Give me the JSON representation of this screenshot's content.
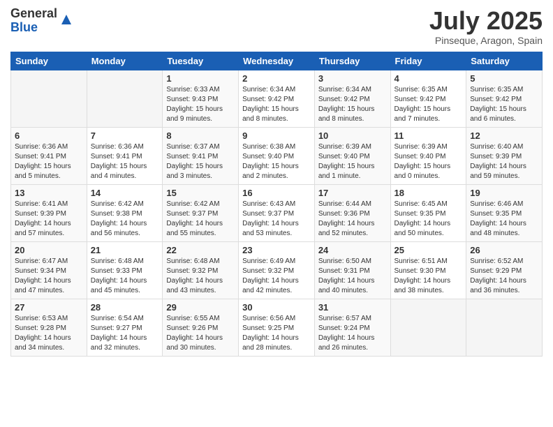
{
  "logo": {
    "general": "General",
    "blue": "Blue"
  },
  "title": "July 2025",
  "location": "Pinseque, Aragon, Spain",
  "days": [
    "Sunday",
    "Monday",
    "Tuesday",
    "Wednesday",
    "Thursday",
    "Friday",
    "Saturday"
  ],
  "weeks": [
    [
      {
        "day": "",
        "content": ""
      },
      {
        "day": "",
        "content": ""
      },
      {
        "day": "1",
        "content": "Sunrise: 6:33 AM\nSunset: 9:43 PM\nDaylight: 15 hours and 9 minutes."
      },
      {
        "day": "2",
        "content": "Sunrise: 6:34 AM\nSunset: 9:42 PM\nDaylight: 15 hours and 8 minutes."
      },
      {
        "day": "3",
        "content": "Sunrise: 6:34 AM\nSunset: 9:42 PM\nDaylight: 15 hours and 8 minutes."
      },
      {
        "day": "4",
        "content": "Sunrise: 6:35 AM\nSunset: 9:42 PM\nDaylight: 15 hours and 7 minutes."
      },
      {
        "day": "5",
        "content": "Sunrise: 6:35 AM\nSunset: 9:42 PM\nDaylight: 15 hours and 6 minutes."
      }
    ],
    [
      {
        "day": "6",
        "content": "Sunrise: 6:36 AM\nSunset: 9:41 PM\nDaylight: 15 hours and 5 minutes."
      },
      {
        "day": "7",
        "content": "Sunrise: 6:36 AM\nSunset: 9:41 PM\nDaylight: 15 hours and 4 minutes."
      },
      {
        "day": "8",
        "content": "Sunrise: 6:37 AM\nSunset: 9:41 PM\nDaylight: 15 hours and 3 minutes."
      },
      {
        "day": "9",
        "content": "Sunrise: 6:38 AM\nSunset: 9:40 PM\nDaylight: 15 hours and 2 minutes."
      },
      {
        "day": "10",
        "content": "Sunrise: 6:39 AM\nSunset: 9:40 PM\nDaylight: 15 hours and 1 minute."
      },
      {
        "day": "11",
        "content": "Sunrise: 6:39 AM\nSunset: 9:40 PM\nDaylight: 15 hours and 0 minutes."
      },
      {
        "day": "12",
        "content": "Sunrise: 6:40 AM\nSunset: 9:39 PM\nDaylight: 14 hours and 59 minutes."
      }
    ],
    [
      {
        "day": "13",
        "content": "Sunrise: 6:41 AM\nSunset: 9:39 PM\nDaylight: 14 hours and 57 minutes."
      },
      {
        "day": "14",
        "content": "Sunrise: 6:42 AM\nSunset: 9:38 PM\nDaylight: 14 hours and 56 minutes."
      },
      {
        "day": "15",
        "content": "Sunrise: 6:42 AM\nSunset: 9:37 PM\nDaylight: 14 hours and 55 minutes."
      },
      {
        "day": "16",
        "content": "Sunrise: 6:43 AM\nSunset: 9:37 PM\nDaylight: 14 hours and 53 minutes."
      },
      {
        "day": "17",
        "content": "Sunrise: 6:44 AM\nSunset: 9:36 PM\nDaylight: 14 hours and 52 minutes."
      },
      {
        "day": "18",
        "content": "Sunrise: 6:45 AM\nSunset: 9:35 PM\nDaylight: 14 hours and 50 minutes."
      },
      {
        "day": "19",
        "content": "Sunrise: 6:46 AM\nSunset: 9:35 PM\nDaylight: 14 hours and 48 minutes."
      }
    ],
    [
      {
        "day": "20",
        "content": "Sunrise: 6:47 AM\nSunset: 9:34 PM\nDaylight: 14 hours and 47 minutes."
      },
      {
        "day": "21",
        "content": "Sunrise: 6:48 AM\nSunset: 9:33 PM\nDaylight: 14 hours and 45 minutes."
      },
      {
        "day": "22",
        "content": "Sunrise: 6:48 AM\nSunset: 9:32 PM\nDaylight: 14 hours and 43 minutes."
      },
      {
        "day": "23",
        "content": "Sunrise: 6:49 AM\nSunset: 9:32 PM\nDaylight: 14 hours and 42 minutes."
      },
      {
        "day": "24",
        "content": "Sunrise: 6:50 AM\nSunset: 9:31 PM\nDaylight: 14 hours and 40 minutes."
      },
      {
        "day": "25",
        "content": "Sunrise: 6:51 AM\nSunset: 9:30 PM\nDaylight: 14 hours and 38 minutes."
      },
      {
        "day": "26",
        "content": "Sunrise: 6:52 AM\nSunset: 9:29 PM\nDaylight: 14 hours and 36 minutes."
      }
    ],
    [
      {
        "day": "27",
        "content": "Sunrise: 6:53 AM\nSunset: 9:28 PM\nDaylight: 14 hours and 34 minutes."
      },
      {
        "day": "28",
        "content": "Sunrise: 6:54 AM\nSunset: 9:27 PM\nDaylight: 14 hours and 32 minutes."
      },
      {
        "day": "29",
        "content": "Sunrise: 6:55 AM\nSunset: 9:26 PM\nDaylight: 14 hours and 30 minutes."
      },
      {
        "day": "30",
        "content": "Sunrise: 6:56 AM\nSunset: 9:25 PM\nDaylight: 14 hours and 28 minutes."
      },
      {
        "day": "31",
        "content": "Sunrise: 6:57 AM\nSunset: 9:24 PM\nDaylight: 14 hours and 26 minutes."
      },
      {
        "day": "",
        "content": ""
      },
      {
        "day": "",
        "content": ""
      }
    ]
  ]
}
